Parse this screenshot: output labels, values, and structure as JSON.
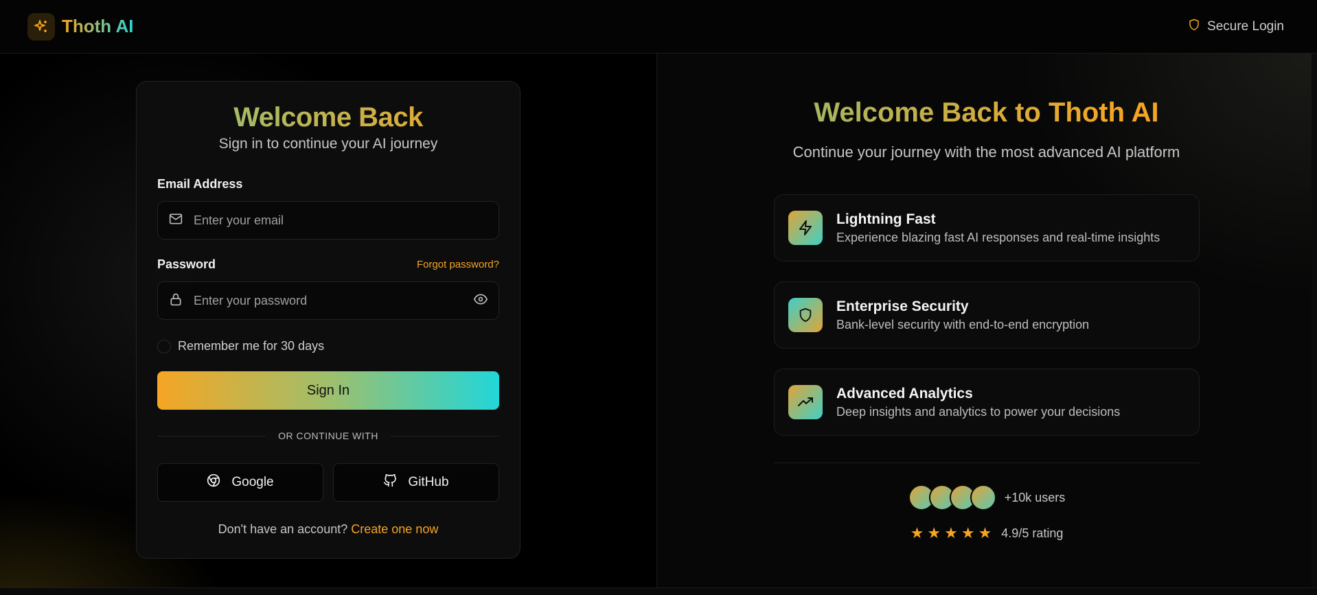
{
  "header": {
    "brand": "Thoth AI",
    "secure_label": "Secure Login"
  },
  "login": {
    "title": "Welcome Back",
    "subtitle": "Sign in to continue your AI journey",
    "email_label": "Email Address",
    "email_placeholder": "Enter your email",
    "password_label": "Password",
    "forgot_label": "Forgot password?",
    "password_placeholder": "Enter your password",
    "remember_label": "Remember me for 30 days",
    "signin_label": "Sign In",
    "divider_label": "OR CONTINUE WITH",
    "google_label": "Google",
    "github_label": "GitHub",
    "signup_prompt": "Don't have an account?",
    "signup_link": "Create one now"
  },
  "promo": {
    "title": "Welcome Back to Thoth AI",
    "subtitle": "Continue your journey with the most advanced AI platform",
    "features": [
      {
        "title": "Lightning Fast",
        "desc": "Experience blazing fast AI responses and real-time insights",
        "icon": "lightning-icon"
      },
      {
        "title": "Enterprise Security",
        "desc": "Bank-level security with end-to-end encryption",
        "icon": "shield-icon"
      },
      {
        "title": "Advanced Analytics",
        "desc": "Deep insights and analytics to power your decisions",
        "icon": "trending-up-icon"
      }
    ],
    "users_label": "+10k users",
    "rating_label": "4.9/5 rating",
    "rating_stars": 5
  },
  "colors": {
    "accent_orange": "#f5a524",
    "accent_cyan": "#22d6d9",
    "background": "#000000"
  }
}
